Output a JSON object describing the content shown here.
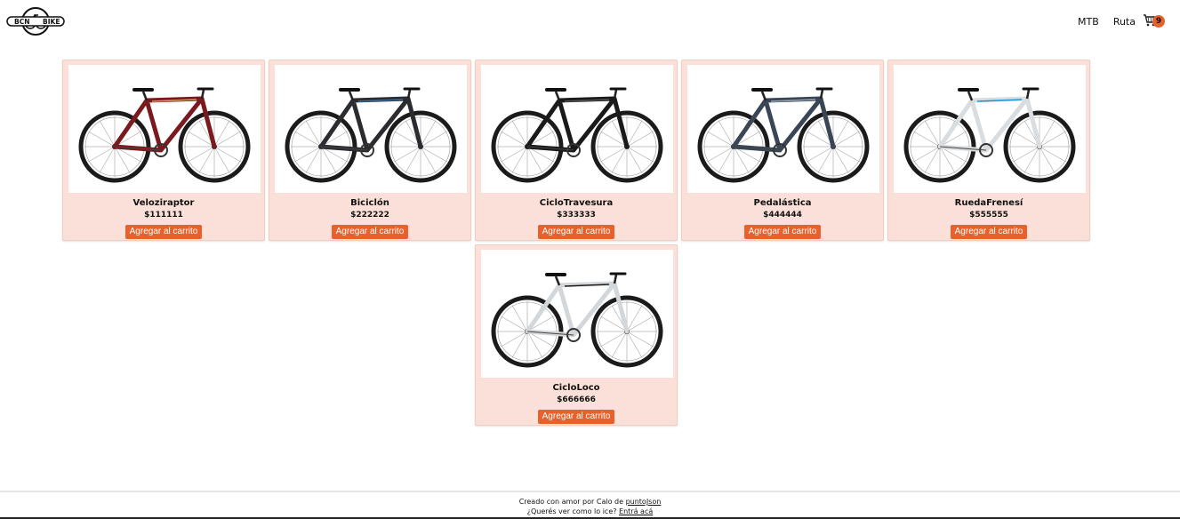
{
  "brand": {
    "logo_text_left": "BCN",
    "logo_text_right": "BIKE",
    "logo_icon": "bike-logo-icon"
  },
  "nav": {
    "links": [
      "MTB",
      "Ruta"
    ],
    "cart_icon": "cart-icon",
    "cart_count": "9"
  },
  "products": [
    {
      "name": "Veloziraptor",
      "price": "$111111",
      "button": "Agregar al carrito",
      "frame_color": "#7a1a1f",
      "accent": "#c9a15a"
    },
    {
      "name": "Biciclón",
      "price": "$222222",
      "button": "Agregar al carrito",
      "frame_color": "#2a2c30",
      "accent": "#3a6f9b"
    },
    {
      "name": "CicloTravesura",
      "price": "$333333",
      "button": "Agregar al carrito",
      "frame_color": "#1a1a1a",
      "accent": "#555555"
    },
    {
      "name": "Pedalástica",
      "price": "$444444",
      "button": "Agregar al carrito",
      "frame_color": "#3a4656",
      "accent": "#9aa4b0"
    },
    {
      "name": "RuedaFrenesí",
      "price": "$555555",
      "button": "Agregar al carrito",
      "frame_color": "#d9dde0",
      "accent": "#1e95d6"
    },
    {
      "name": "CicloLoco",
      "price": "$666666",
      "button": "Agregar al carrito",
      "frame_color": "#d4d7d9",
      "accent": "#222222"
    }
  ],
  "footer": {
    "line1_text": "Creado con amor por Calo de ",
    "line1_link": "puntoJson",
    "line2_text": "¿Querés ver como lo ice? ",
    "line2_link": "Entrá acá"
  },
  "colors": {
    "accent": "#e8602c",
    "card_bg": "#fae0d8"
  }
}
